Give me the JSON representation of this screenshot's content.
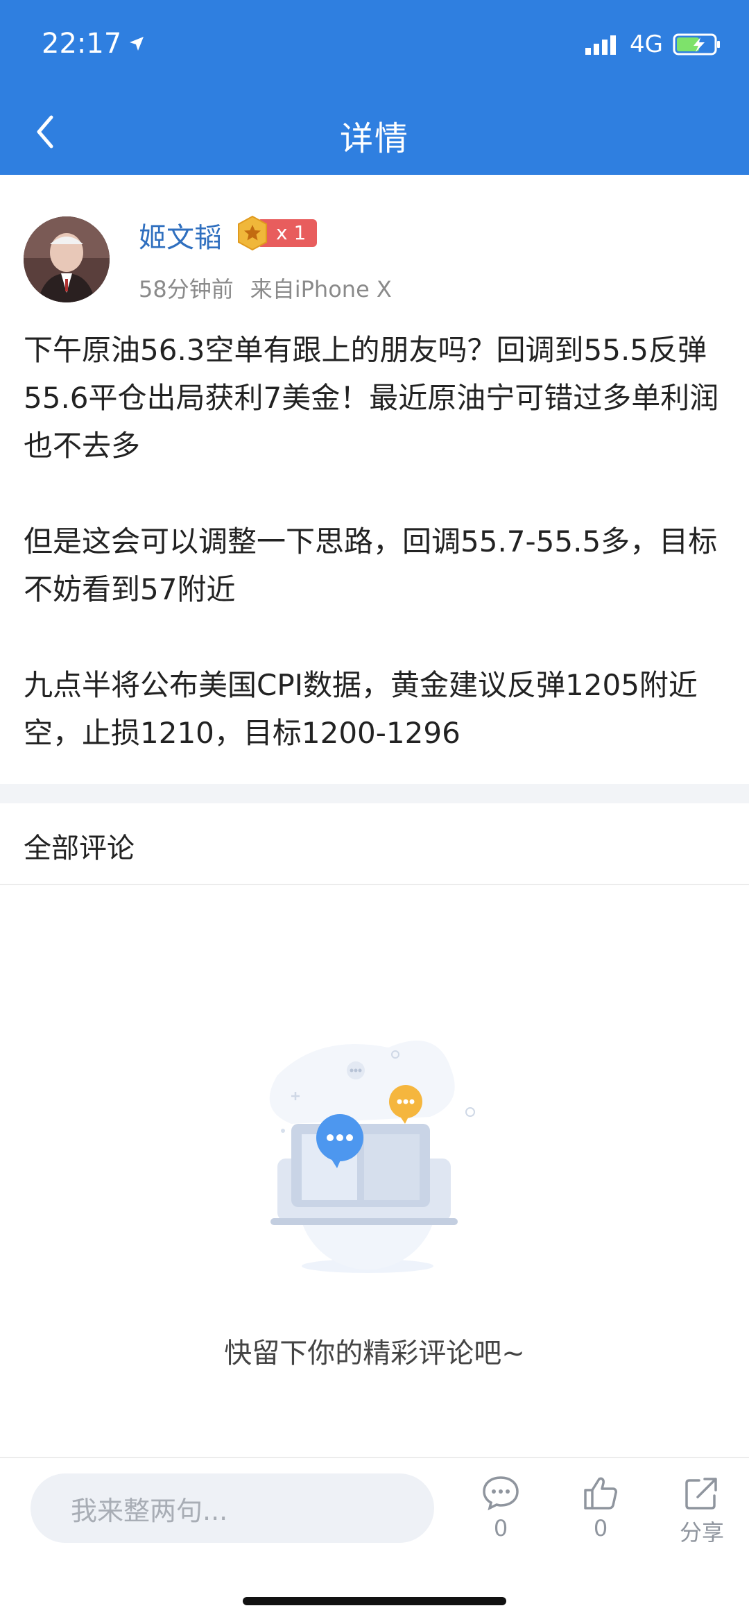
{
  "status_bar": {
    "time": "22:17",
    "network": "4G"
  },
  "nav": {
    "title": "详情"
  },
  "post": {
    "author": "姬文韬",
    "badge_count": "x 1",
    "time_ago": "58分钟前",
    "source": "来自iPhone X",
    "paragraphs": [
      "下午原油56.3空单有跟上的朋友吗？回调到55.5反弹55.6平仓出局获利7美金！最近原油宁可错过多单利润也不去多",
      "但是这会可以调整一下思路，回调55.7-55.5多，目标不妨看到57附近",
      "九点半将公布美国CPI数据，黄金建议反弹1205附近空，止损1210，目标1200-1296"
    ]
  },
  "comments": {
    "section_title": "全部评论",
    "empty_text": "快留下你的精彩评论吧~"
  },
  "bottom_bar": {
    "input_placeholder": "我来整两句...",
    "comment_count": "0",
    "like_count": "0",
    "share_label": "分享"
  },
  "colors": {
    "brand": "#2f7fe0",
    "username": "#2f6fbf",
    "badge": "#e85d5d"
  },
  "icons": [
    "back-arrow-icon",
    "location-arrow-icon",
    "signal-icon",
    "battery-icon",
    "comment-icon",
    "like-icon",
    "share-icon"
  ]
}
